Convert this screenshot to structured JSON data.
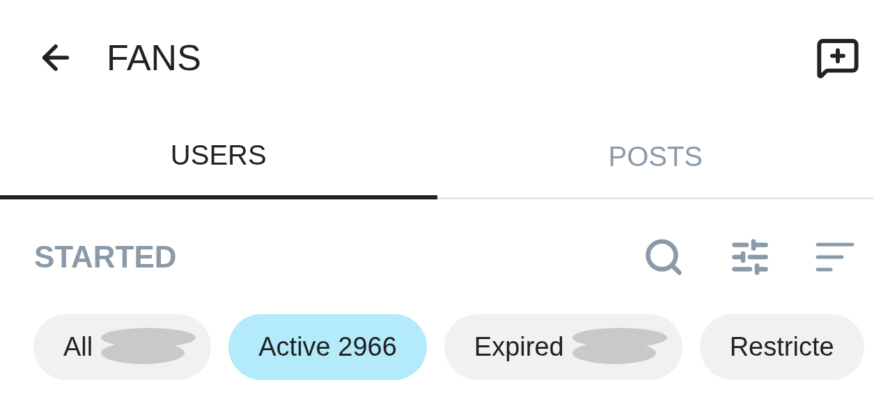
{
  "header": {
    "title": "FANS"
  },
  "tabs": [
    {
      "label": "USERS",
      "selected": true
    },
    {
      "label": "POSTS",
      "selected": false
    }
  ],
  "section": {
    "title": "STARTED"
  },
  "chips": [
    {
      "label": "All",
      "selected": false,
      "redacted": true
    },
    {
      "label": "Active 2966",
      "selected": true,
      "redacted": false
    },
    {
      "label": "Expired",
      "selected": false,
      "redacted": true
    },
    {
      "label": "Restricte",
      "selected": false,
      "redacted": false
    }
  ]
}
